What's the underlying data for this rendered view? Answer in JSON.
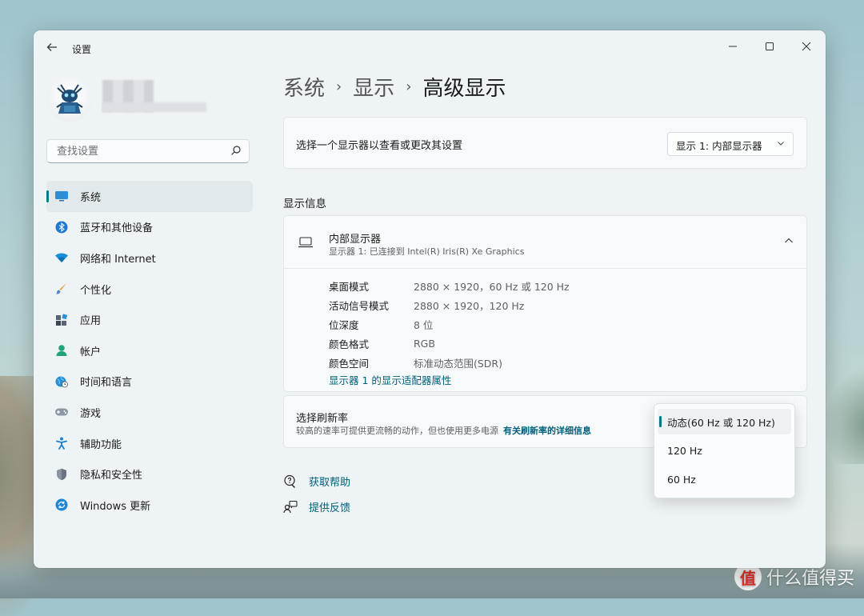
{
  "window": {
    "title": "设置"
  },
  "search": {
    "placeholder": "查找设置"
  },
  "sidebar": {
    "items": [
      {
        "label": "系统",
        "icon": "system-display-icon",
        "active": true
      },
      {
        "label": "蓝牙和其他设备",
        "icon": "bluetooth-icon"
      },
      {
        "label": "网络和 Internet",
        "icon": "wifi-icon"
      },
      {
        "label": "个性化",
        "icon": "brush-icon"
      },
      {
        "label": "应用",
        "icon": "apps-icon"
      },
      {
        "label": "帐户",
        "icon": "account-icon"
      },
      {
        "label": "时间和语言",
        "icon": "globe-clock-icon"
      },
      {
        "label": "游戏",
        "icon": "gamepad-icon"
      },
      {
        "label": "辅助功能",
        "icon": "accessibility-icon"
      },
      {
        "label": "隐私和安全性",
        "icon": "shield-icon"
      },
      {
        "label": "Windows 更新",
        "icon": "update-icon"
      }
    ]
  },
  "breadcrumb": {
    "level1": "系统",
    "level2": "显示",
    "current": "高级显示",
    "separator": "›"
  },
  "select_display": {
    "label": "选择一个显示器以查看或更改其设置",
    "value": "显示 1: 内部显示器"
  },
  "display_info": {
    "section_title": "显示信息",
    "name": "内部显示器",
    "subtitle": "显示器 1: 已连接到 Intel(R) Iris(R) Xe Graphics",
    "rows": [
      {
        "key": "桌面模式",
        "value": "2880 × 1920，60 Hz 或 120 Hz"
      },
      {
        "key": "活动信号模式",
        "value": "2880 × 1920，120 Hz"
      },
      {
        "key": "位深度",
        "value": "8 位"
      },
      {
        "key": "颜色格式",
        "value": "RGB"
      },
      {
        "key": "颜色空间",
        "value": "标准动态范围(SDR)"
      }
    ],
    "adapter_link": "显示器 1 的显示适配器属性"
  },
  "refresh_rate": {
    "title": "选择刷新率",
    "description": "较高的速率可提供更流畅的动作，但也使用更多电源",
    "link": "有关刷新率的详细信息",
    "options": [
      "动态(60 Hz 或 120 Hz)",
      "120 Hz",
      "60 Hz"
    ],
    "selected": "动态(60 Hz 或 120 Hz)"
  },
  "help": {
    "get_help": "获取帮助",
    "feedback": "提供反馈"
  },
  "watermark": {
    "badge": "值",
    "text": "什么值得买"
  },
  "colors": {
    "accent": "#007a86",
    "link": "#00607a",
    "window_bg": "#eef4f6"
  }
}
